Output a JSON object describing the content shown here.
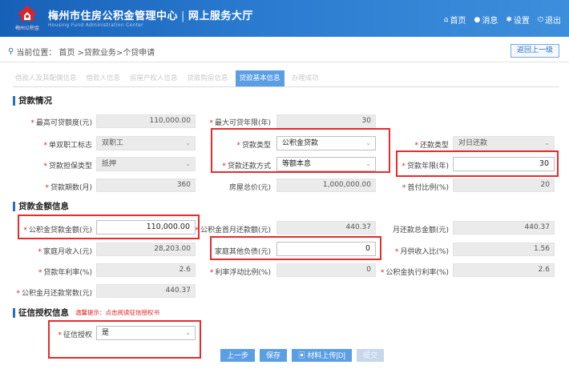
{
  "header": {
    "logo_text": "梅州公积金",
    "title": "梅州市住房公积金管理中心",
    "title_sep": "|",
    "subtitle_main": "网上服务大厅",
    "subtitle_en": "Housing Fund Administration Center",
    "nav": [
      {
        "icon": "home-icon",
        "label": "首页"
      },
      {
        "icon": "message-icon",
        "label": "消息"
      },
      {
        "icon": "settings-icon",
        "label": "设置"
      },
      {
        "icon": "power-icon",
        "label": "退出"
      }
    ]
  },
  "breadcrumb": {
    "prefix": "当前位置：",
    "path": "首页 >贷款业务>个贷申请",
    "back_label": "返回上一级"
  },
  "tabs": [
    "借款人及其配偶信息",
    "借款人信息",
    "房屋产权人信息",
    "贷款购房信息",
    "贷款基本信息",
    "办理成功"
  ],
  "active_tab": 4,
  "sections": {
    "loan_info": "贷款情况",
    "amount_info": "贷款金额信息",
    "credit_info": "征信授权信息",
    "credit_tip": "温馨提示：点击阅读征信授权书"
  },
  "loan_info": {
    "max_amount_label": "最高可贷额度(元)",
    "max_amount": "110,000.00",
    "max_years_label": "最大可贷年限(年)",
    "max_years": "30",
    "dual_label": "单双职工标志",
    "dual": "双职工",
    "loan_type_label": "贷款类型",
    "loan_type": "公积金贷款",
    "repay_type_label": "还款类型",
    "repay_type": "对日还款",
    "guarantee_label": "贷款担保类型",
    "guarantee": "抵押",
    "repay_method_label": "贷款还款方式",
    "repay_method": "等额本息",
    "loan_years_label": "贷款年限(年)",
    "loan_years": "30",
    "loan_months_label": "贷款期数(月)",
    "loan_months": "360",
    "house_price_label": "房屋总价(元)",
    "house_price": "1,000,000.00",
    "down_ratio_label": "首付比例(%)",
    "down_ratio": "20"
  },
  "amount_info": {
    "fund_amount_label": "公积金贷款金额(元)",
    "fund_amount": "110,000.00",
    "first_month_label": "公积金首月还款额(元)",
    "first_month": "440.37",
    "monthly_total_label": "月还款总金额(元)",
    "monthly_total": "440.37",
    "family_income_label": "家庭月收入(元)",
    "family_income": "28,203.00",
    "other_debt_label": "家庭其他负债(元)",
    "other_debt": "0",
    "income_ratio_label": "月供收入比(%)",
    "income_ratio": "1.56",
    "annual_rate_label": "贷款年利率(%)",
    "annual_rate": "2.6",
    "float_ratio_label": "利率浮动比例(%)",
    "float_ratio": "0",
    "exec_rate_label": "公积金执行利率(%)",
    "exec_rate": "2.6",
    "monthly_fixed_label": "公积金月还款常数(元)",
    "monthly_fixed": "440.37"
  },
  "credit": {
    "auth_label": "征信授权",
    "auth": "是"
  },
  "buttons": {
    "prev": "上一步",
    "save": "保存",
    "upload": "材料上传[D]",
    "submit": "提交"
  }
}
